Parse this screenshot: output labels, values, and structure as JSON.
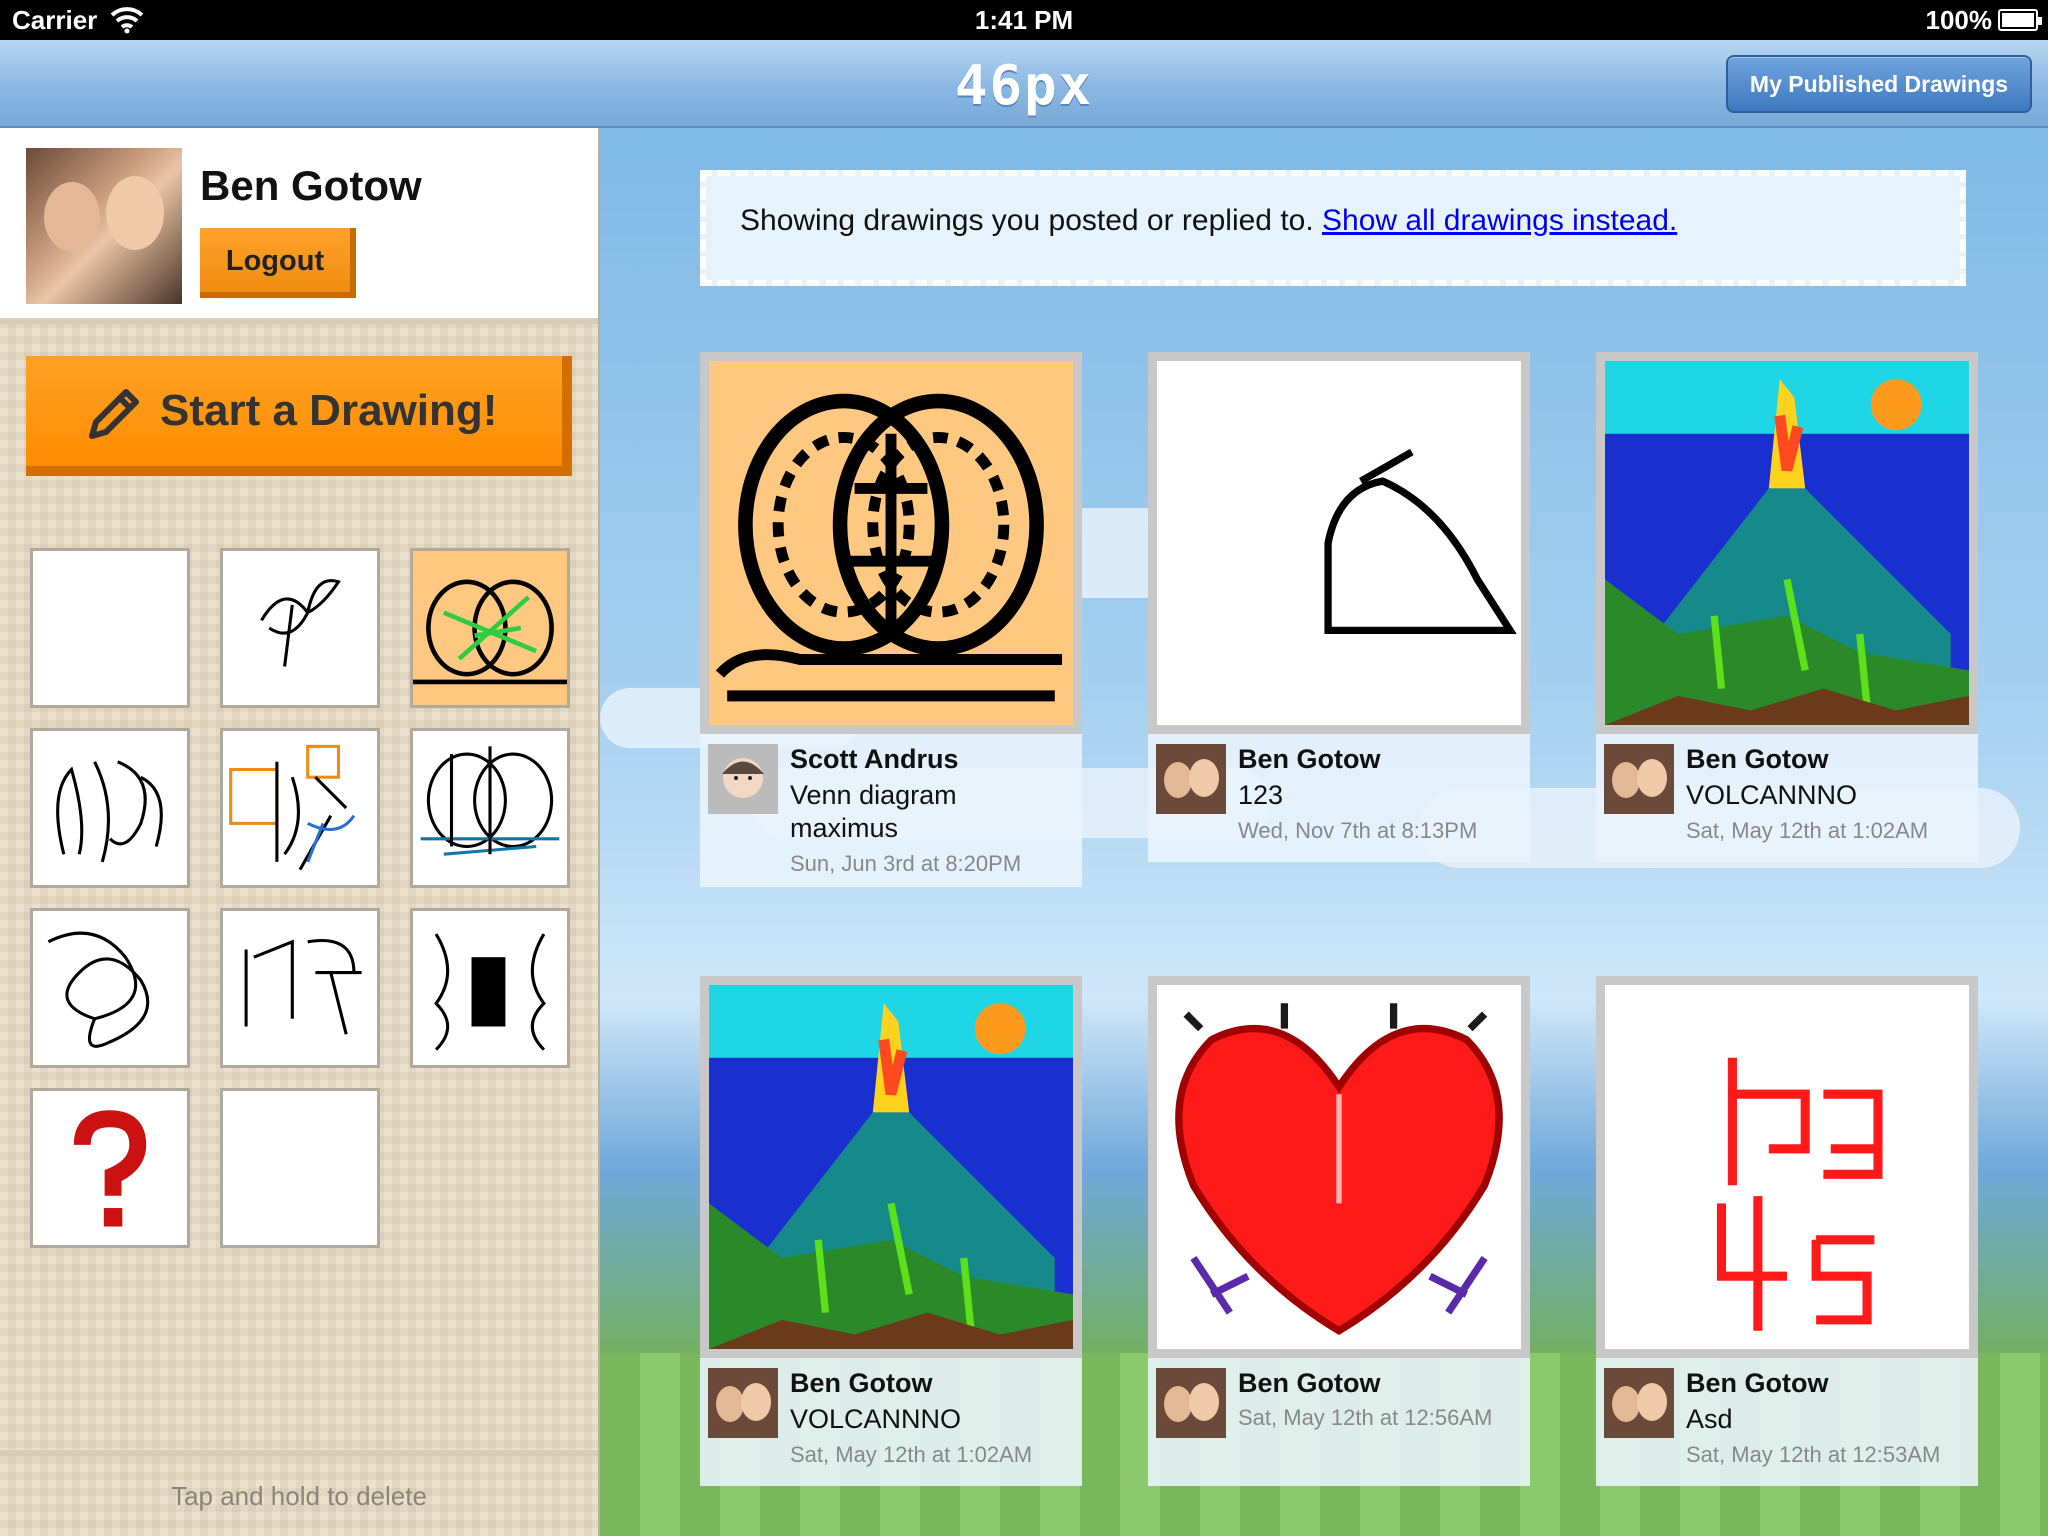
{
  "status_bar": {
    "carrier": "Carrier",
    "time": "1:41 PM",
    "battery": "100%"
  },
  "nav": {
    "logo": "46px",
    "published_button": "My Published Drawings"
  },
  "profile": {
    "name": "Ben Gotow",
    "logout": "Logout"
  },
  "sidebar": {
    "start_button": "Start a Drawing!",
    "hint": "Tap and hold to delete",
    "thumbnails": [
      "blank",
      "scribble-leaf",
      "venn-green",
      "scribble-loops",
      "orange-boxes",
      "venn-teal",
      "scribble-knot",
      "scribble-letters",
      "black-bar",
      "question-mark",
      "blank"
    ]
  },
  "main": {
    "filter_text": "Showing drawings you posted or replied to.",
    "filter_link": "Show all drawings instead.",
    "cards": [
      {
        "author": "Scott Andrus",
        "title": "Venn diagram maximus",
        "date": "Sun, Jun 3rd at 8:20PM"
      },
      {
        "author": "Ben Gotow",
        "title": "123",
        "date": "Wed, Nov 7th at 8:13PM"
      },
      {
        "author": "Ben Gotow",
        "title": "VOLCANNNO",
        "date": "Sat, May 12th at 1:02AM"
      },
      {
        "author": "Ben Gotow",
        "title": "VOLCANNNO",
        "date": "Sat, May 12th at 1:02AM"
      },
      {
        "author": "Ben Gotow",
        "title": "",
        "date": "Sat, May 12th at 12:56AM"
      },
      {
        "author": "Ben Gotow",
        "title": "Asd",
        "date": "Sat, May 12th at 12:53AM"
      }
    ]
  },
  "colors": {
    "accent_orange": "#ff8c00",
    "nav_blue": "#8ab8e3",
    "link": "#0000ee"
  }
}
